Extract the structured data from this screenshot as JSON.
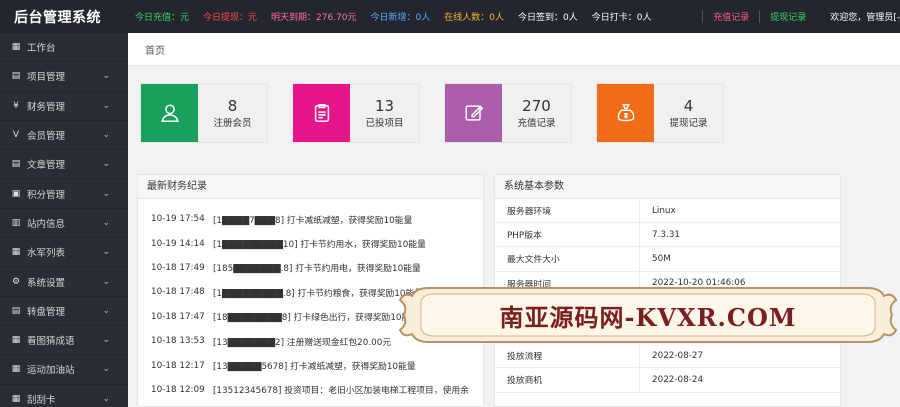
{
  "brand": "后台管理系统",
  "stats": [
    {
      "text": "今日充值：元",
      "color": "#3dd36b"
    },
    {
      "text": "今日提现：元",
      "color": "#ff4a4a"
    },
    {
      "text": "明天到期：276.70元",
      "color": "#ff6fa3"
    },
    {
      "text": "今日新增：0人",
      "color": "#5aa9ff"
    },
    {
      "text": "在线人数：0人",
      "color": "#ffb22e"
    },
    {
      "text": "今日签到：0人",
      "color": "#ffffff"
    },
    {
      "text": "今日打卡：0人",
      "color": "#ffffff"
    }
  ],
  "top_links": {
    "recharge": {
      "text": "充值记录",
      "color": "#ff5a8a"
    },
    "withdraw": {
      "text": "提现记录",
      "color": "#3dd36b"
    },
    "welcome": "欢迎您，管理员[-"
  },
  "sidebar": {
    "items": [
      {
        "label": "工作台",
        "icon": "dashboard-icon",
        "glyph": "▦",
        "chevron": false
      },
      {
        "label": "项目管理",
        "icon": "list-icon",
        "glyph": "▤",
        "chevron": true
      },
      {
        "label": "财务管理",
        "icon": "yen-icon",
        "glyph": "¥",
        "chevron": true
      },
      {
        "label": "会员管理",
        "icon": "vip-icon",
        "glyph": "V",
        "chevron": true
      },
      {
        "label": "文章管理",
        "icon": "document-icon",
        "glyph": "▤",
        "chevron": true
      },
      {
        "label": "积分管理",
        "icon": "points-icon",
        "glyph": "▣",
        "chevron": true
      },
      {
        "label": "站内信息",
        "icon": "message-icon",
        "glyph": "▥",
        "chevron": true
      },
      {
        "label": "水军列表",
        "icon": "grid-icon",
        "glyph": "▦",
        "chevron": true
      },
      {
        "label": "系统设置",
        "icon": "gear-icon",
        "glyph": "⚙",
        "chevron": true
      },
      {
        "label": "转盘管理",
        "icon": "wheel-icon",
        "glyph": "▤",
        "chevron": true
      },
      {
        "label": "看图猜成语",
        "icon": "image-icon",
        "glyph": "▦",
        "chevron": true
      },
      {
        "label": "运动加油站",
        "icon": "sport-icon",
        "glyph": "▦",
        "chevron": true
      },
      {
        "label": "刮刮卡",
        "icon": "card-icon",
        "glyph": "▦",
        "chevron": true
      }
    ],
    "chevron_glyph": "⌄"
  },
  "breadcrumb": "首页",
  "cards": [
    {
      "value": "8",
      "label": "注册会员",
      "color": "#18a05c",
      "icon": "user-icon"
    },
    {
      "value": "13",
      "label": "已投项目",
      "color": "#e6168a",
      "icon": "clipboard-icon"
    },
    {
      "value": "270",
      "label": "充值记录",
      "color": "#ab5ea9",
      "icon": "edit-icon"
    },
    {
      "value": "4",
      "label": "提现记录",
      "color": "#f26b17",
      "icon": "money-bag-icon"
    }
  ],
  "finance_panel": {
    "title": "最新财务纪录",
    "records": [
      {
        "time": "10-19 17:54",
        "info": "[1▇▇▇▇7▇▇▇8] 打卡减纸减塑，获得奖励10能量"
      },
      {
        "time": "10-19 14:14",
        "info": "[1▇▇▇▇▇▇▇▇▇10] 打卡节约用水，获得奖励10能量"
      },
      {
        "time": "10-18 17:49",
        "info": "[185▇▇▇▇▇▇▇.8] 打卡节约用电，获得奖励10能量"
      },
      {
        "time": "10-18 17:48",
        "info": "[1▇▇▇▇▇▇▇▇▇.8] 打卡节约粮食，获得奖励10能量"
      },
      {
        "time": "10-18 17:47",
        "info": "[18▇▇▇▇▇▇▇▇8] 打卡绿色出行，获得奖励10能量"
      },
      {
        "time": "10-18 13:53",
        "info": "[13▇▇▇▇▇▇▇2] 注册赠送现金红包20.00元"
      },
      {
        "time": "10-18 12:17",
        "info": "[13▇▇▇▇▇5678] 打卡减纸减塑，获得奖励10能量"
      },
      {
        "time": "10-18 12:09",
        "info": "[13512345678] 投资项目：老旧小区加装电梯工程项目，使用余"
      }
    ]
  },
  "system_panel": {
    "title": "系统基本参数",
    "params": [
      {
        "key": "服务器环境",
        "value": "Linux"
      },
      {
        "key": "PHP版本",
        "value": "7.3.31"
      },
      {
        "key": "最大文件大小",
        "value": "50M"
      },
      {
        "key": "服务器时间",
        "value": "2022-10-20 01:46:06"
      },
      {
        "key": "",
        "value": ""
      },
      {
        "key": "",
        "value": ""
      },
      {
        "key": "投放流程",
        "value": "2022-08-27"
      },
      {
        "key": "投放商机",
        "value": "2022-08-24"
      }
    ]
  },
  "watermark": {
    "text": "南亚源码网-KVXR.COM",
    "color": "#7a1f1f"
  }
}
